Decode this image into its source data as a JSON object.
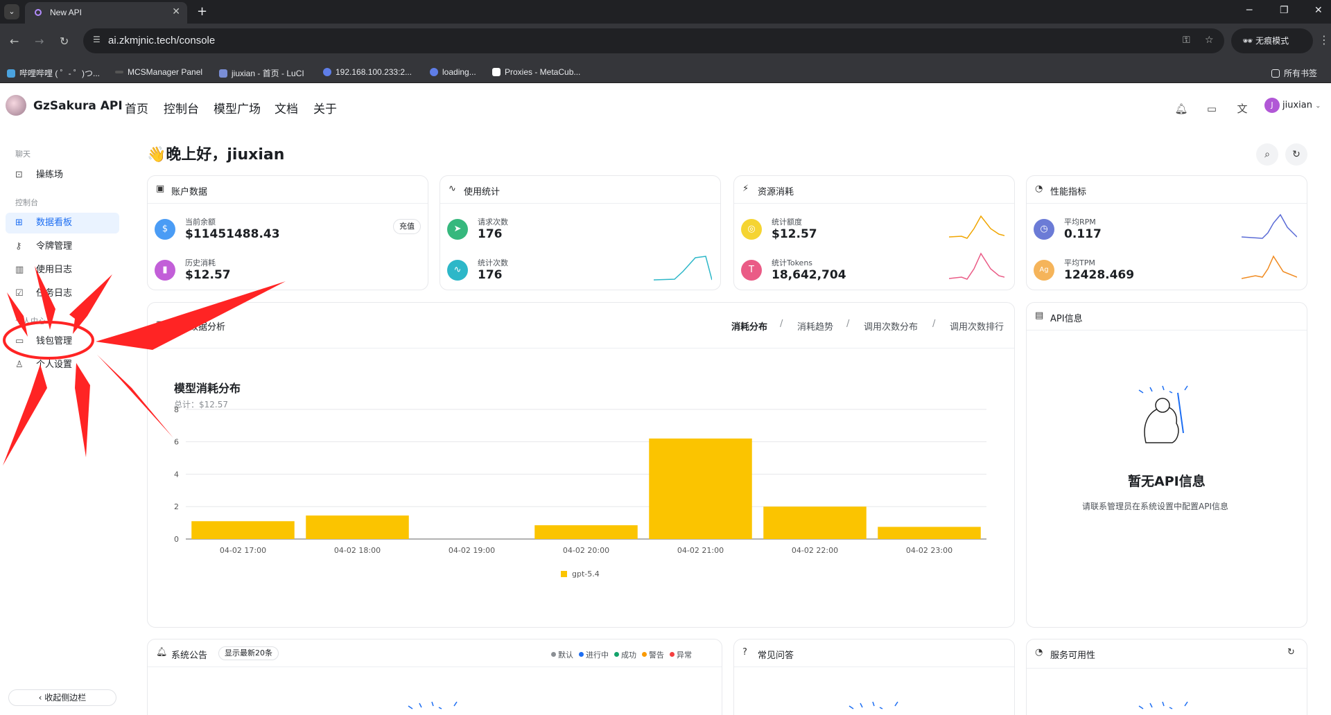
{
  "browser": {
    "tab_title": "New API",
    "url": "ai.zkmjnic.tech/console",
    "incognito_label": "无痕模式",
    "bookmarks": [
      "哔哩哔哩 ( ゜- ゜)つ...",
      "MCSManager Panel",
      "jiuxian - 首页 - LuCI",
      "192.168.100.233:2...",
      "loading...",
      "Proxies - MetaCub..."
    ],
    "all_bookmarks": "所有书签"
  },
  "header": {
    "brand": "GzSakura API",
    "nav": [
      "首页",
      "控制台",
      "模型广场",
      "文档",
      "关于"
    ],
    "user": "jiuxian",
    "user_initial": "J"
  },
  "sidebar": {
    "section_chat": "聊天",
    "playground": "操练场",
    "section_console": "控制台",
    "items": [
      "数据看板",
      "令牌管理",
      "使用日志",
      "任务日志"
    ],
    "section_personal": "个人中心",
    "wallet": "钱包管理",
    "settings": "个人设置",
    "collapse": "收起侧边栏"
  },
  "greeting": "👋晚上好，jiuxian",
  "cards": {
    "account": {
      "title": "账户数据",
      "balance_label": "当前余额",
      "balance": "$11451488.43",
      "recharge": "充值",
      "spent_label": "历史消耗",
      "spent": "$12.57"
    },
    "usage": {
      "title": "使用统计",
      "req_label": "请求次数",
      "req": "176",
      "stat_label": "统计次数",
      "stat": "176"
    },
    "resource": {
      "title": "资源消耗",
      "quota_label": "统计额度",
      "quota": "$12.57",
      "tokens_label": "统计Tokens",
      "tokens": "18,642,704"
    },
    "performance": {
      "title": "性能指标",
      "rpm_label": "平均RPM",
      "rpm": "0.117",
      "tpm_label": "平均TPM",
      "tpm": "12428.469",
      "tpm_badge": "Ag"
    }
  },
  "analysis": {
    "title": "模型数据分析",
    "tabs": [
      "消耗分布",
      "消耗趋势",
      "调用次数分布",
      "调用次数排行"
    ],
    "chart_title": "模型消耗分布",
    "chart_subtitle": "总计：$12.57"
  },
  "chart_data": {
    "type": "bar",
    "categories": [
      "04-02 17:00",
      "04-02 18:00",
      "04-02 19:00",
      "04-02 20:00",
      "04-02 21:00",
      "04-02 22:00",
      "04-02 23:00"
    ],
    "series": [
      {
        "name": "gpt-5.4",
        "values": [
          1.1,
          1.45,
          0,
          0.85,
          6.2,
          2.0,
          0.75
        ],
        "color": "#fbc400"
      }
    ],
    "yticks": [
      0,
      2,
      4,
      6,
      8
    ],
    "ylim": [
      0,
      8
    ],
    "legend": "bottom-center"
  },
  "api_info": {
    "title": "API信息",
    "empty_title": "暂无API信息",
    "empty_sub": "请联系管理员在系统设置中配置API信息"
  },
  "notice": {
    "title": "系统公告",
    "badge": "显示最新20条",
    "legend": [
      {
        "label": "默认",
        "color": "#8b8f94"
      },
      {
        "label": "进行中",
        "color": "#1d6ef2"
      },
      {
        "label": "成功",
        "color": "#13a36b"
      },
      {
        "label": "警告",
        "color": "#fa9a00"
      },
      {
        "label": "异常",
        "color": "#f53f3f"
      }
    ]
  },
  "faq": {
    "title": "常见问答"
  },
  "availability": {
    "title": "服务可用性"
  },
  "colors": {
    "accent": "#1d6ef2",
    "bar": "#fbc400",
    "arrow": "#ff2424"
  }
}
